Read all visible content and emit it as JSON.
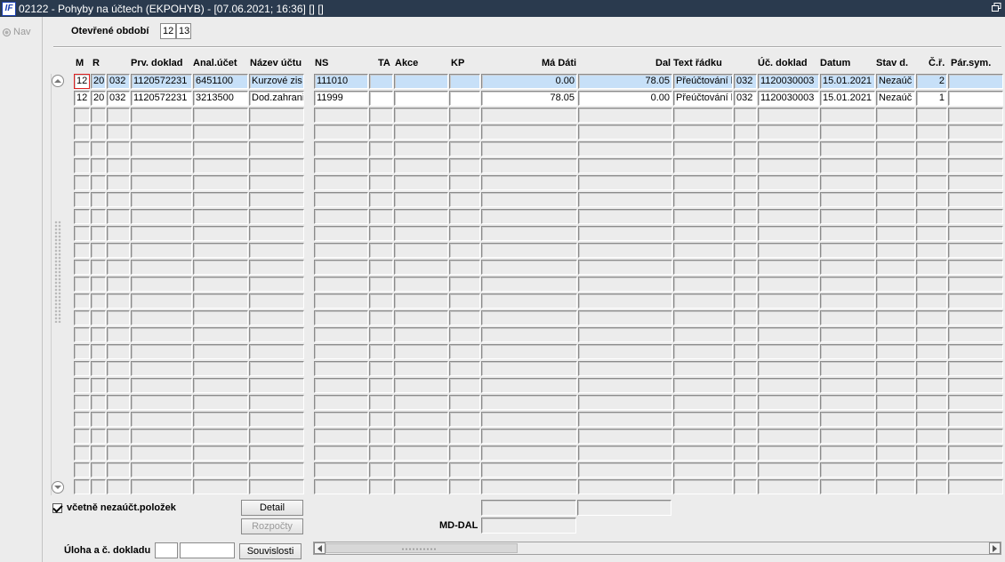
{
  "window": {
    "title": "02122 - Pohyby na účtech (EKPOHYB) - [07.06.2021; 16:36] [] []",
    "logo": "IF"
  },
  "nav": {
    "label": "Nav"
  },
  "period": {
    "label": "Otevřené období",
    "values": [
      "12",
      "13"
    ]
  },
  "columns": [
    "M",
    "R",
    "Prv. doklad",
    "Anal.účet",
    "Název účtu",
    "NS",
    "TA",
    "Akce",
    "KP",
    "Má Dáti",
    "Dal",
    "Text řádku",
    "Úč. doklad",
    "Datum",
    "Stav d.",
    "Č.ř.",
    "Pár.sym."
  ],
  "rows": [
    {
      "m": "12",
      "r": "20",
      "p": "032",
      "prv": "1120572231",
      "anal": "6451100",
      "nazev": "Kurzové zis",
      "ns": "111010",
      "ta": "",
      "akce": "",
      "kp": "",
      "ma_dati": "0.00",
      "dal": "78.05",
      "text": "Přeúčtování k",
      "u": "032",
      "uc_doklad": "1120030003",
      "datum": "15.01.2021",
      "stav": "Nezaúč",
      "cr": "2",
      "par": ""
    },
    {
      "m": "12",
      "r": "20",
      "p": "032",
      "prv": "1120572231",
      "anal": "3213500",
      "nazev": "Dod.zahrani",
      "ns": "11999",
      "ta": "",
      "akce": "",
      "kp": "",
      "ma_dati": "78.05",
      "dal": "0.00",
      "text": "Přeúčtování k",
      "u": "032",
      "uc_doklad": "1120030003",
      "datum": "15.01.2021",
      "stav": "Nezaúč",
      "cr": "1",
      "par": ""
    }
  ],
  "footer": {
    "checkbox_label": "včetně nezaúčt.položek",
    "detail_button": "Detail",
    "rozpocty_button": "Rozpočty",
    "md_dal_label": "MD-DAL",
    "task_label": "Úloha a č. dokladu",
    "souvislosti_button": "Souvislosti"
  },
  "colors": {
    "titlebar": "#2a3a4e",
    "selected_row": "#c7e0f8",
    "focus_border": "#e02020"
  }
}
